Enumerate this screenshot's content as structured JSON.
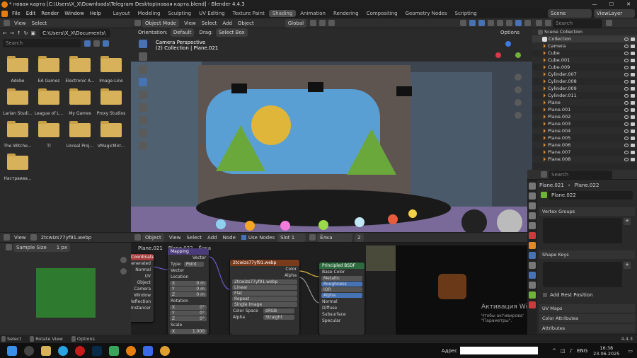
{
  "window": {
    "title": "* новая карта [C:\\Users\\X_X\\Downloads\\Telegram Desktop\\новая карта.blend] - Blender 4.4.3"
  },
  "menu": {
    "items": [
      "File",
      "Edit",
      "Render",
      "Window",
      "Help"
    ],
    "workspaces": [
      "Layout",
      "Modeling",
      "Sculpting",
      "UV Editing",
      "Texture Paint",
      "Shading",
      "Animation",
      "Rendering",
      "Compositing",
      "Geometry Nodes",
      "Scripting"
    ],
    "active_workspace": "Shading",
    "scene_label": "Scene",
    "view_layer_label": "ViewLayer"
  },
  "file_browser": {
    "view_label": "View",
    "select_label": "Select",
    "path": "C:\\Users\\X_X\\Documents\\",
    "search_placeholder": "Search",
    "folders": [
      "Adobe",
      "EA Games",
      "Electronic A...",
      "Image-Line",
      "Larian Studi...",
      "League of L...",
      "My Games",
      "Proxy Studios",
      "The Witche...",
      "TI",
      "Unreal Proj...",
      "VMagicMirr...",
      "Настраива..."
    ]
  },
  "viewport": {
    "mode": "Object Mode",
    "menu": [
      "View",
      "Select",
      "Add",
      "Object"
    ],
    "orientation_label": "Orientation:",
    "orientation_value": "Default",
    "drag_label": "Drag:",
    "drag_value": "Select Box",
    "transform_space": "Global",
    "options_label": "Options",
    "camera_title": "Camera Perspective",
    "camera_subtitle": "(2) Collection | Plane.021"
  },
  "outliner": {
    "search_placeholder": "Search",
    "root": "Scene Collection",
    "collection": "Collection",
    "items": [
      "Camera",
      "Cube",
      "Cube.001",
      "Cube.009",
      "Cylinder.007",
      "Cylinder.008",
      "Cylinder.009",
      "Cylinder.011",
      "Plane",
      "Plane.001",
      "Plane.002",
      "Plane.003",
      "Plane.004",
      "Plane.005",
      "Plane.006",
      "Plane.007",
      "Plane.008"
    ]
  },
  "properties": {
    "search_placeholder": "Search",
    "object_name": "Plane.021",
    "mesh_name": "Plane.022",
    "data_name": "Plane.022",
    "panels": [
      "Vertex Groups",
      "Shape Keys",
      "UV Maps",
      "Color Attributes",
      "Attributes"
    ],
    "add_rest_position": "Add Rest Position"
  },
  "image_editor": {
    "view_label": "View",
    "image_name": "2tcwizs77yf91.webp",
    "sample_size_label": "Sample Size",
    "sample_size_value": "1 px"
  },
  "node_editor": {
    "type": "Object",
    "menu": [
      "View",
      "Select",
      "Add",
      "Node"
    ],
    "use_nodes_label": "Use Nodes",
    "slot": "Slot 1",
    "material": "Ёлка",
    "users": "2",
    "breadcrumb": [
      "Plane.021",
      "Plane.022",
      "Ёлка"
    ],
    "texcoord_outputs": [
      "Generated",
      "Normal",
      "UV",
      "Object",
      "Camera",
      "Window",
      "Reflection"
    ],
    "texcoord_header": "Coordinate",
    "texcoord_footer": "Instancer",
    "mapping": {
      "header": "Mapping",
      "output": "Vector",
      "type_label": "Type:",
      "type_value": "Point",
      "vector_label": "Vector",
      "location_label": "Location",
      "rotation_label": "Rotation",
      "scale_label": "Scale",
      "location": [
        {
          "axis": "X",
          "value": "0 m"
        },
        {
          "axis": "Y",
          "value": "0 m"
        },
        {
          "axis": "Z",
          "value": "0 m"
        }
      ],
      "rotation": [
        {
          "axis": "X",
          "value": "0°"
        },
        {
          "axis": "Y",
          "value": "0°"
        },
        {
          "axis": "Z",
          "value": "0°"
        }
      ],
      "scale_x": "X",
      "scale_x_value": "1.000"
    },
    "image_node": {
      "header": "2tcwizs77yf91.webp",
      "outputs": [
        "Color",
        "Alpha"
      ],
      "image_field": "2tcwizs77yf91.webp",
      "interpolation": "Linear",
      "projection": "Flat",
      "extension": "Repeat",
      "source": "Single Image",
      "color_space_label": "Color Space",
      "color_space_value": "sRGB",
      "alpha_label": "Alpha",
      "alpha_value": "Straight"
    },
    "bsdf": {
      "header": "Principled BSDF",
      "base_color": "Base Color",
      "fields": [
        "Metallic",
        "Roughness",
        "IOR",
        "Alpha"
      ],
      "normal": "Normal",
      "sections": [
        "Diffuse",
        "Subsurface",
        "Specular"
      ]
    },
    "watermark_title": "Активация Windows",
    "watermark_sub1": "Чтобы активировать Windows, перейдите в раздел",
    "watermark_sub2": "\"Параметры\"."
  },
  "statusbar": {
    "select": "Select",
    "rotate": "Rotate View",
    "options": "Options",
    "version": "4.4.3"
  },
  "taskbar": {
    "address_label": "Адрес",
    "language": "ENG",
    "time": "16:38",
    "date": "23.06.2025"
  },
  "colors": {
    "accent": "#4772b3",
    "orange": "#e08a2c",
    "folder": "#d8b25a",
    "bsdf_header": "#2d6a3e",
    "image_header": "#7a3b1d",
    "mapping_header": "#4a3b7a"
  }
}
